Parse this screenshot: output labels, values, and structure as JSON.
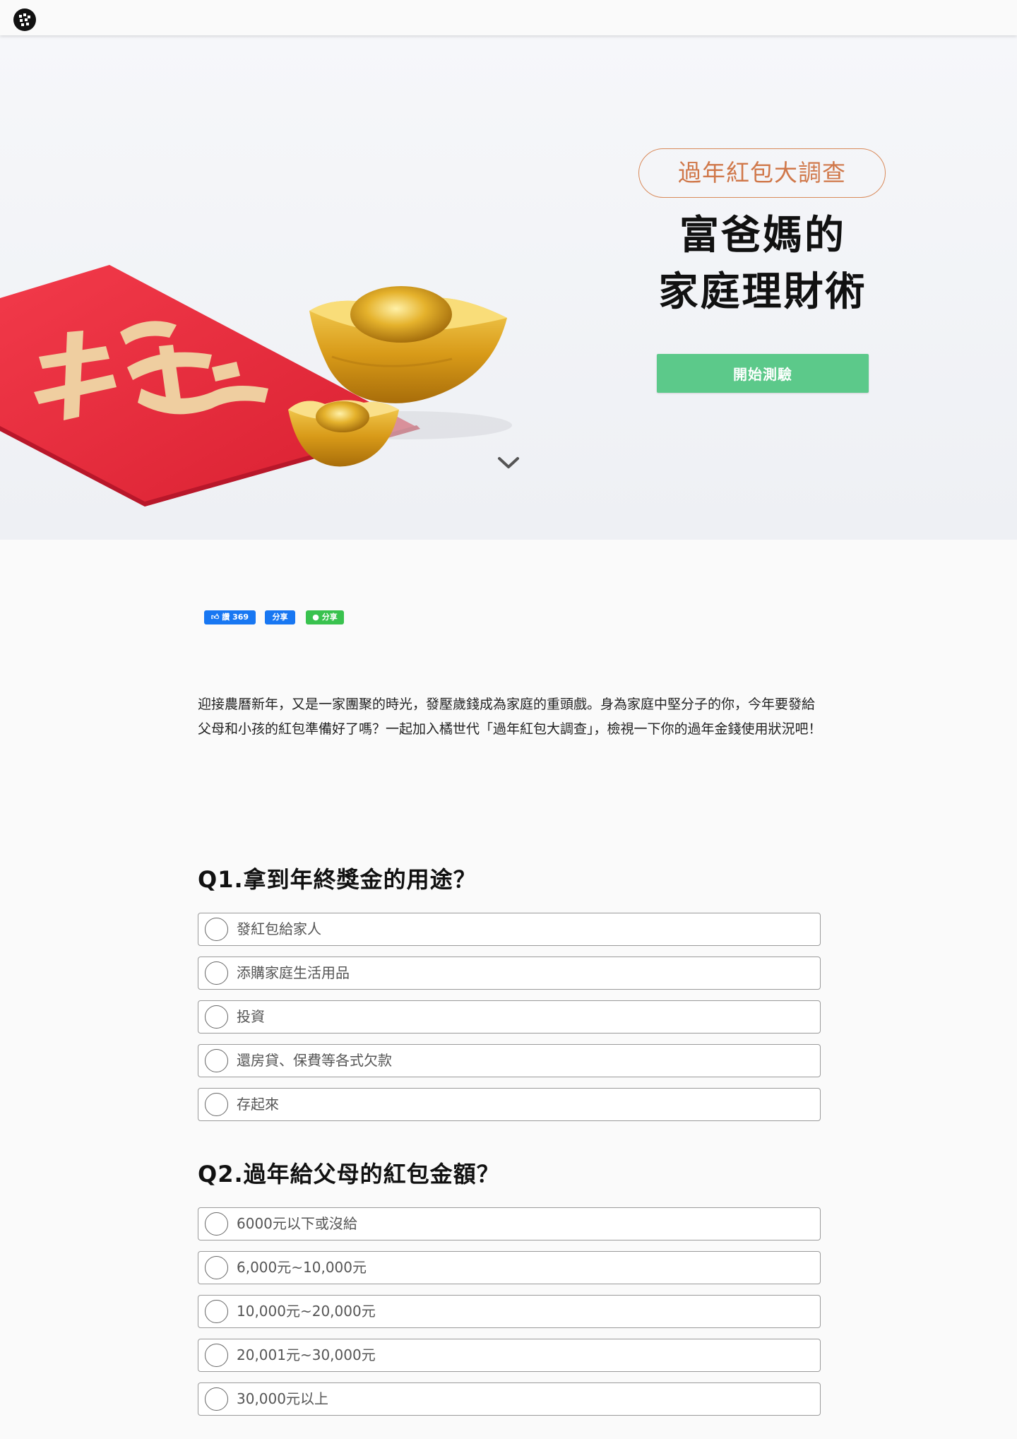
{
  "header": {
    "logo_icon": "orange-generation-logo-icon"
  },
  "hero": {
    "badge": "過年紅包大調查",
    "title_line1": "富爸媽的",
    "title_line2": "家庭理財術",
    "cta_label": "開始測驗",
    "red_envelope_char": "播",
    "scroll_icon": "chevron-down-icon"
  },
  "share": {
    "fb_like_label": "讚 369",
    "fb_share_label": "分享",
    "line_share_label": "分享"
  },
  "intro": "迎接農曆新年，又是一家團聚的時光，發壓歲錢成為家庭的重頭戲。身為家庭中堅分子的你，今年要發給父母和小孩的紅包準備好了嗎？一起加入橘世代「過年紅包大調查」，檢視一下你的過年金錢使用狀況吧！",
  "questions": [
    {
      "title": "Q1.拿到年終獎金的用途？",
      "options": [
        "發紅包給家人",
        "添購家庭生活用品",
        "投資",
        "還房貸、保費等各式欠款",
        "存起來"
      ]
    },
    {
      "title": "Q2.過年給父母的紅包金額？",
      "options": [
        "6000元以下或沒給",
        "6,000元~10,000元",
        "10,000元~20,000元",
        "20,001元~30,000元",
        "30,000元以上"
      ]
    }
  ],
  "colors": {
    "accent_green": "#5cc98a",
    "badge_orange": "#d0784a",
    "facebook_blue": "#1877f2",
    "line_green": "#39c24e",
    "envelope_red": "#e8283a",
    "ingot_gold": "#d9a520"
  }
}
